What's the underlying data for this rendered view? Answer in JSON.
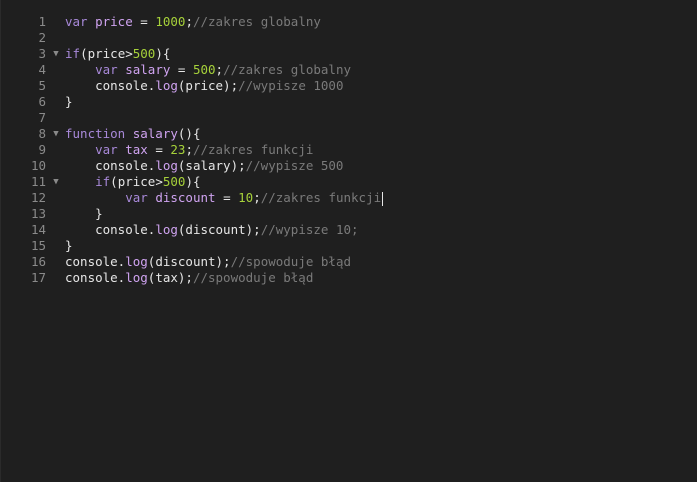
{
  "editor": {
    "lines": [
      {
        "number": "1",
        "fold": "",
        "tokens": [
          {
            "t": "kw",
            "v": "var "
          },
          {
            "t": "fn",
            "v": "price"
          },
          {
            "t": "op",
            "v": " = "
          },
          {
            "t": "num",
            "v": "1000"
          },
          {
            "t": "op",
            "v": ";"
          },
          {
            "t": "cm",
            "v": "//zakres globalny"
          }
        ]
      },
      {
        "number": "2",
        "fold": "",
        "tokens": []
      },
      {
        "number": "3",
        "fold": "▼",
        "tokens": [
          {
            "t": "kw",
            "v": "if"
          },
          {
            "t": "op",
            "v": "(price>"
          },
          {
            "t": "num",
            "v": "500"
          },
          {
            "t": "op",
            "v": "){"
          }
        ]
      },
      {
        "number": "4",
        "fold": "",
        "tokens": [
          {
            "t": "op",
            "v": "    "
          },
          {
            "t": "kw",
            "v": "var "
          },
          {
            "t": "fn",
            "v": "salary"
          },
          {
            "t": "op",
            "v": " = "
          },
          {
            "t": "num",
            "v": "500"
          },
          {
            "t": "op",
            "v": ";"
          },
          {
            "t": "cm",
            "v": "//zakres globalny"
          }
        ]
      },
      {
        "number": "5",
        "fold": "",
        "tokens": [
          {
            "t": "op",
            "v": "    console."
          },
          {
            "t": "fn",
            "v": "log"
          },
          {
            "t": "op",
            "v": "(price);"
          },
          {
            "t": "cm",
            "v": "//wypisze 1000"
          }
        ]
      },
      {
        "number": "6",
        "fold": "",
        "tokens": [
          {
            "t": "op",
            "v": "}"
          }
        ]
      },
      {
        "number": "7",
        "fold": "",
        "tokens": []
      },
      {
        "number": "8",
        "fold": "▼",
        "tokens": [
          {
            "t": "kw",
            "v": "function "
          },
          {
            "t": "fn",
            "v": "salary"
          },
          {
            "t": "op",
            "v": "(){"
          }
        ]
      },
      {
        "number": "9",
        "fold": "",
        "tokens": [
          {
            "t": "op",
            "v": "    "
          },
          {
            "t": "kw",
            "v": "var "
          },
          {
            "t": "fn",
            "v": "tax"
          },
          {
            "t": "op",
            "v": " = "
          },
          {
            "t": "num",
            "v": "23"
          },
          {
            "t": "op",
            "v": ";"
          },
          {
            "t": "cm",
            "v": "//zakres funkcji"
          }
        ]
      },
      {
        "number": "10",
        "fold": "",
        "tokens": [
          {
            "t": "op",
            "v": "    console."
          },
          {
            "t": "fn",
            "v": "log"
          },
          {
            "t": "op",
            "v": "(salary);"
          },
          {
            "t": "cm",
            "v": "//wypisze 500"
          }
        ]
      },
      {
        "number": "11",
        "fold": "▼",
        "tokens": [
          {
            "t": "op",
            "v": "    "
          },
          {
            "t": "kw",
            "v": "if"
          },
          {
            "t": "op",
            "v": "(price>"
          },
          {
            "t": "num",
            "v": "500"
          },
          {
            "t": "op",
            "v": "){"
          }
        ]
      },
      {
        "number": "12",
        "fold": "",
        "caret": true,
        "tokens": [
          {
            "t": "op",
            "v": "        "
          },
          {
            "t": "kw",
            "v": "var "
          },
          {
            "t": "fn",
            "v": "discount"
          },
          {
            "t": "op",
            "v": " = "
          },
          {
            "t": "num",
            "v": "10"
          },
          {
            "t": "op",
            "v": ";"
          },
          {
            "t": "cm",
            "v": "//zakres funkcji"
          }
        ]
      },
      {
        "number": "13",
        "fold": "",
        "tokens": [
          {
            "t": "op",
            "v": "    }"
          }
        ]
      },
      {
        "number": "14",
        "fold": "",
        "tokens": [
          {
            "t": "op",
            "v": "    console."
          },
          {
            "t": "fn",
            "v": "log"
          },
          {
            "t": "op",
            "v": "(discount);"
          },
          {
            "t": "cm",
            "v": "//wypisze 10;"
          }
        ]
      },
      {
        "number": "15",
        "fold": "",
        "tokens": [
          {
            "t": "op",
            "v": "}"
          }
        ]
      },
      {
        "number": "16",
        "fold": "",
        "tokens": [
          {
            "t": "op",
            "v": "console."
          },
          {
            "t": "fn",
            "v": "log"
          },
          {
            "t": "op",
            "v": "(discount);"
          },
          {
            "t": "cm",
            "v": "//spowoduje błąd"
          }
        ]
      },
      {
        "number": "17",
        "fold": "",
        "tokens": [
          {
            "t": "op",
            "v": "console."
          },
          {
            "t": "fn",
            "v": "log"
          },
          {
            "t": "op",
            "v": "(tax);"
          },
          {
            "t": "cm",
            "v": "//spowoduje błąd"
          }
        ]
      }
    ],
    "colors": {
      "background": "#1f1f1f",
      "keyword": "#a889d9",
      "identifier": "#cfa3f0",
      "number": "#a6d13a",
      "comment": "#7a7a7a",
      "text": "#e6e6e6",
      "line_number": "#8a8a8a"
    },
    "icons": {
      "fold": "fold-arrow-icon"
    }
  }
}
